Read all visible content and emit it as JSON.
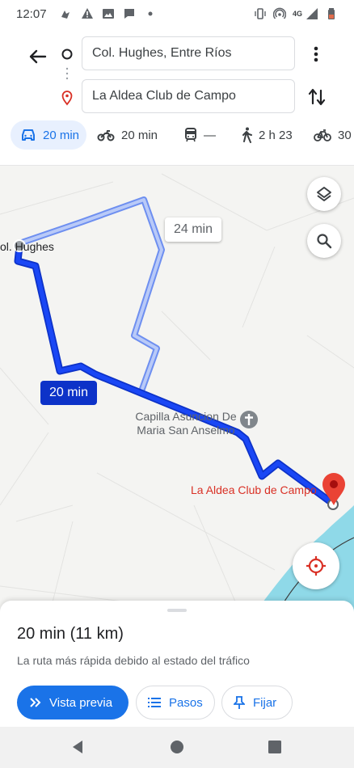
{
  "status_bar": {
    "time": "12:07",
    "network": "4G",
    "icons_left": [
      "cast-icon",
      "warning-icon",
      "image-icon",
      "chat-icon",
      "dot-icon"
    ],
    "icons_right": [
      "vibrate-icon",
      "hotspot-icon",
      "signal-icon",
      "battery-icon"
    ]
  },
  "route": {
    "origin": "Col. Hughes, Entre Ríos",
    "destination": "La Aldea Club de Campo"
  },
  "modes": [
    {
      "name": "car",
      "label": "20 min",
      "selected": true
    },
    {
      "name": "motorcycle",
      "label": "20 min",
      "selected": false
    },
    {
      "name": "transit",
      "label": "—",
      "selected": false
    },
    {
      "name": "walk",
      "label": "2 h 23",
      "selected": false
    },
    {
      "name": "bike",
      "label": "30",
      "selected": false
    }
  ],
  "map": {
    "origin_label": "ol. Hughes",
    "alt_route_time": "24 min",
    "main_route_time": "20 min",
    "poi_chapel": "Capilla Asuncion De Maria San Anselmo",
    "destination_label": "La Aldea Club de Campo",
    "colors": {
      "main_route": "#1a3ef0",
      "alt_route": "#8aa4f5",
      "water": "#8fd9e8",
      "destination": "#d93025"
    }
  },
  "sheet": {
    "summary": "20 min (11 km)",
    "subtitle": "La ruta más rápida debido al estado del tráfico",
    "buttons": {
      "preview": "Vista previa",
      "steps": "Pasos",
      "pin": "Fijar"
    }
  }
}
